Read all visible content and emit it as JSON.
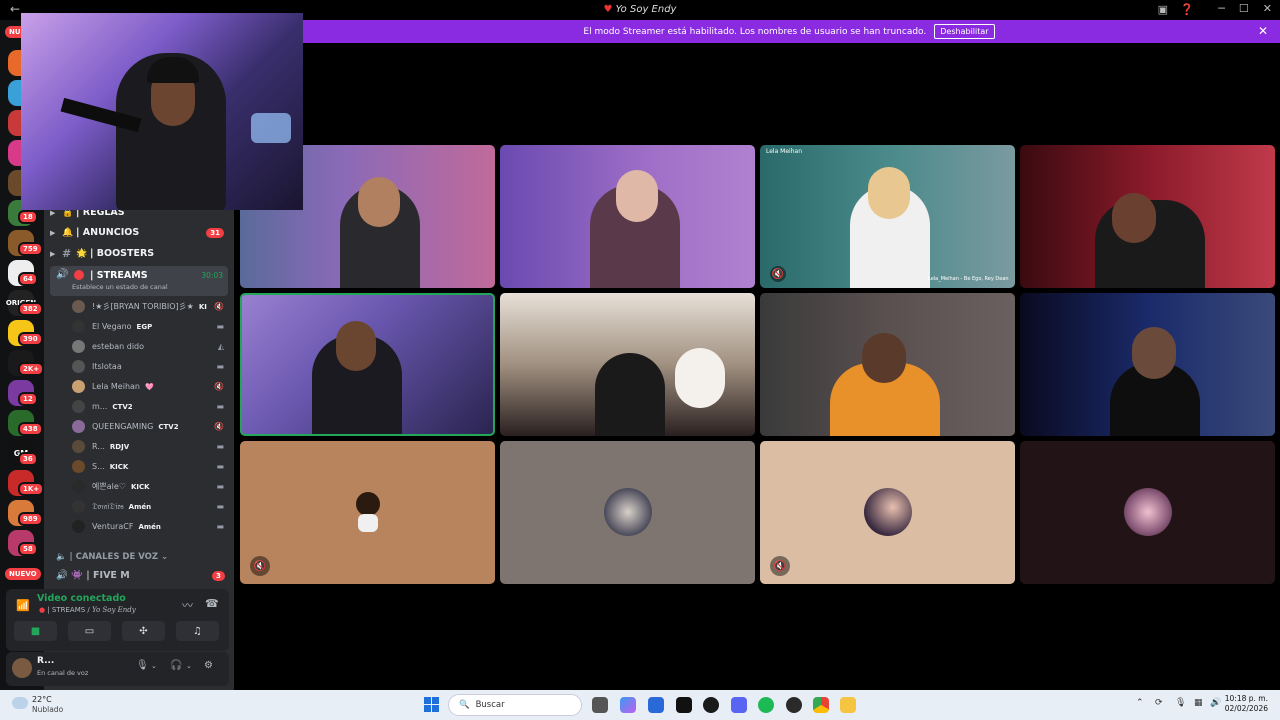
{
  "window": {
    "title": "Yo Soy Endy"
  },
  "banner": {
    "text": "El modo Streamer está habilitado. Los nombres de usuario se han truncado.",
    "button": "Deshabilitar"
  },
  "servers": {
    "badges": [
      "18",
      "759",
      "64",
      "382",
      "390",
      "2K+",
      "12",
      "438",
      "36",
      "1K+",
      "989",
      "58"
    ],
    "labels": [
      "ORIGEN",
      "GM"
    ],
    "new_pills": [
      "NUEVO",
      "NUEVO"
    ]
  },
  "channels": [
    {
      "name": "| REGLAS",
      "emoji": "🔒",
      "badge": ""
    },
    {
      "name": "| ANUNCIOS",
      "emoji": "🔔",
      "badge": "31"
    },
    {
      "name": "| BOOSTERS",
      "emoji": "🌟",
      "badge": ""
    }
  ],
  "streams_channel": {
    "name": "| STREAMS",
    "time": "30:03",
    "sub": "Establece un estado de canal"
  },
  "voice_users": [
    {
      "name": "!★彡[BRYAN TORIBIO]彡★",
      "tag": "KI",
      "status": "🔇"
    },
    {
      "name": "El Vegano",
      "tag": "EGP",
      "status": "▬"
    },
    {
      "name": "esteban dido",
      "tag": "",
      "status": "◭"
    },
    {
      "name": "Itslotaa",
      "tag": "",
      "status": "▬"
    },
    {
      "name": "Lela Meihan",
      "tag": "🩷",
      "status": "🔇"
    },
    {
      "name": "m...",
      "tag": "CTV2",
      "status": "▬"
    },
    {
      "name": "QUEENGAMING",
      "tag": "CTV2",
      "status": "🔇"
    },
    {
      "name": "R...",
      "tag": "RDJV",
      "status": "▬"
    },
    {
      "name": "S...",
      "tag": "KICK",
      "status": "▬"
    },
    {
      "name": "예쁜ale♡",
      "tag": "KICK",
      "status": "▬"
    },
    {
      "name": "𝔇𝔬𝔪𝔦𝔇𝔦𝔬𝔰",
      "tag": "Amén",
      "status": "▬"
    },
    {
      "name": "VenturaCF",
      "tag": "Amén",
      "status": "▬"
    }
  ],
  "voice_category": "CANALES DE VOZ",
  "fivem": {
    "name": "| FIVE M",
    "badge": "3"
  },
  "voice_panel": {
    "title": "Video conectado",
    "channel": "| STREAMS /",
    "server": "Yo Soy Endy"
  },
  "user": {
    "name": "R...",
    "status": "En canal de voz"
  },
  "tile_labels": [
    "Lela Meihan",
    "Lela_Meihan - Be Ego, Rey Dean"
  ],
  "taskbar": {
    "temp": "22°C",
    "weather": "Nublado",
    "search": "Buscar",
    "time": "10:18 p. m.",
    "date": "02/02/2026"
  },
  "colors": {
    "accent": "#8a2be2",
    "green": "#23a55a",
    "red": "#f23f43",
    "sidebar": "#2b2d31"
  }
}
